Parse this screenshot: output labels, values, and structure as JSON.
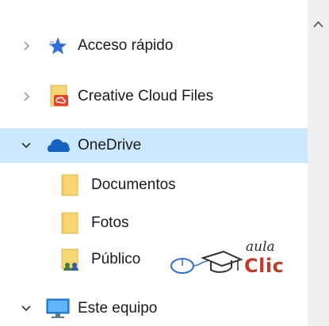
{
  "nav_pane": {
    "items": [
      {
        "label": "Acceso rápido",
        "icon": "star-icon",
        "expand_state": "collapsed",
        "level": 0
      },
      {
        "label": "Creative Cloud Files",
        "icon": "creative-cloud-folder-icon",
        "expand_state": "collapsed",
        "level": 0
      },
      {
        "label": "OneDrive",
        "icon": "onedrive-cloud-icon",
        "expand_state": "expanded",
        "level": 0,
        "selected": true
      },
      {
        "label": "Documentos",
        "icon": "folder-icon",
        "level": 1
      },
      {
        "label": "Fotos",
        "icon": "folder-icon",
        "level": 1
      },
      {
        "label": "Público",
        "icon": "shared-folder-icon",
        "level": 1
      },
      {
        "label": "Este equipo",
        "icon": "computer-icon",
        "expand_state": "expanded",
        "level": 0
      }
    ]
  },
  "watermark": {
    "top": "aula",
    "bottom": "Clic"
  },
  "colors": {
    "selection": "#cce8ff",
    "folder": "#f7d774",
    "star": "#2f6fd6",
    "onedrive": "#1565c0",
    "watermark_red": "#c0392b"
  }
}
